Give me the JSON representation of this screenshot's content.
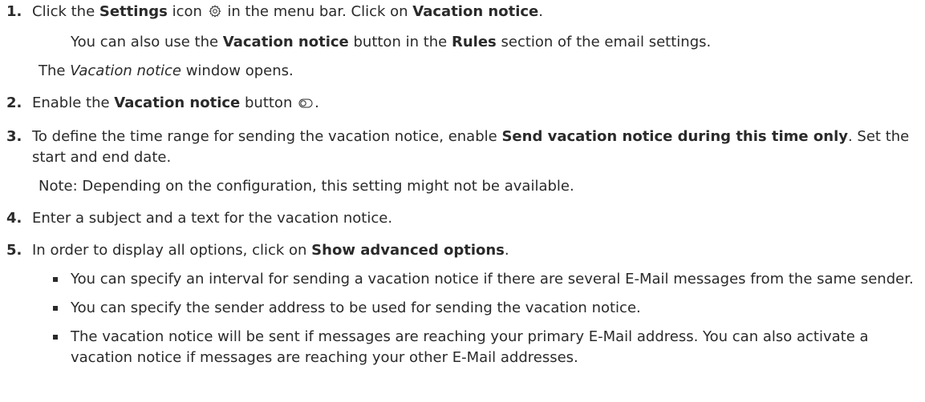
{
  "steps": [
    {
      "num": "1.",
      "parts": [
        "Click the ",
        "Settings",
        " icon ",
        " in the menu bar. Click on ",
        "Vacation notice",
        "."
      ],
      "icon": "gear-icon",
      "sub": [
        "You can also use the ",
        "Vacation notice",
        " button in the ",
        "Rules",
        " section of the email settings."
      ],
      "result": [
        "The ",
        "Vacation notice",
        " window opens."
      ]
    },
    {
      "num": "2.",
      "parts": [
        "Enable the ",
        "Vacation notice",
        " button ",
        "."
      ],
      "icon": "toggle-icon"
    },
    {
      "num": "3.",
      "parts": [
        "To define the time range for sending the vacation notice, enable ",
        "Send vacation notice during this time only",
        ". Set the start and end date."
      ],
      "note": "Note: Depending on the configuration, this setting might not be available."
    },
    {
      "num": "4.",
      "text": "Enter a subject and a text for the vacation notice."
    },
    {
      "num": "5.",
      "parts": [
        "In order to display all options, click on ",
        "Show advanced options",
        "."
      ],
      "bullets": [
        "You can specify an interval for sending a vacation notice if there are several E-Mail messages from the same sender.",
        "You can specify the sender address to be used for sending the vacation notice.",
        "The vacation notice will be sent if messages are reaching your primary E-Mail address. You can also activate a vacation notice if messages are reaching your other E-Mail addresses."
      ]
    }
  ]
}
